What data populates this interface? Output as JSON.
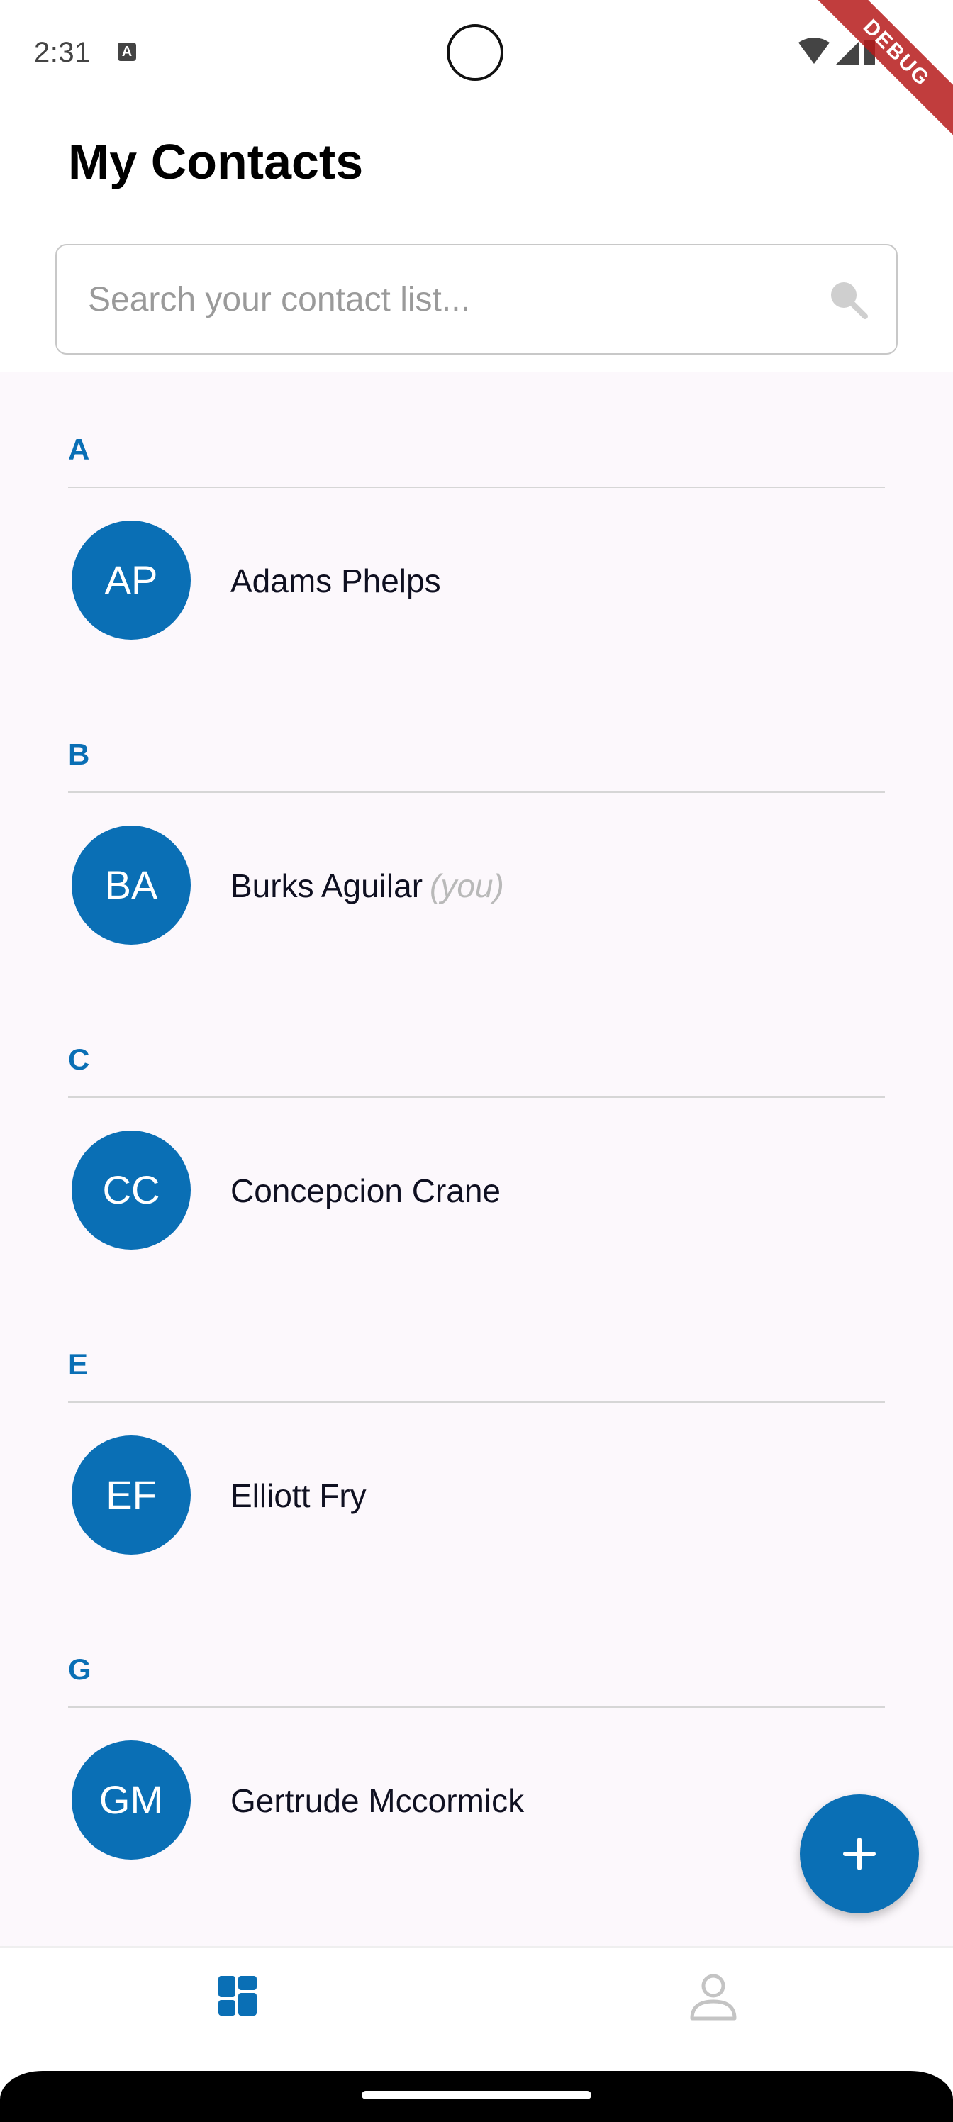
{
  "status_bar": {
    "time": "2:31",
    "debug_label": "DEBUG"
  },
  "header": {
    "title": "My Contacts"
  },
  "search": {
    "placeholder": "Search your contact list..."
  },
  "sections": [
    {
      "letter": "A",
      "contacts": [
        {
          "initials": "AP",
          "name": "Adams Phelps",
          "tag": ""
        }
      ]
    },
    {
      "letter": "B",
      "contacts": [
        {
          "initials": "BA",
          "name": "Burks Aguilar",
          "tag": "(you)"
        }
      ]
    },
    {
      "letter": "C",
      "contacts": [
        {
          "initials": "CC",
          "name": "Concepcion Crane",
          "tag": ""
        }
      ]
    },
    {
      "letter": "E",
      "contacts": [
        {
          "initials": "EF",
          "name": "Elliott Fry",
          "tag": ""
        }
      ]
    },
    {
      "letter": "G",
      "contacts": [
        {
          "initials": "GM",
          "name": "Gertrude Mccormick",
          "tag": ""
        }
      ]
    }
  ],
  "fab": {
    "icon": "plus-icon"
  },
  "bottom_nav": {
    "items": [
      {
        "icon": "dashboard-icon",
        "active": true
      },
      {
        "icon": "person-icon",
        "active": false
      }
    ]
  },
  "colors": {
    "accent": "#0a6fb5",
    "list_background": "#fcf8fc",
    "inactive_icon": "#c4c4c4"
  }
}
